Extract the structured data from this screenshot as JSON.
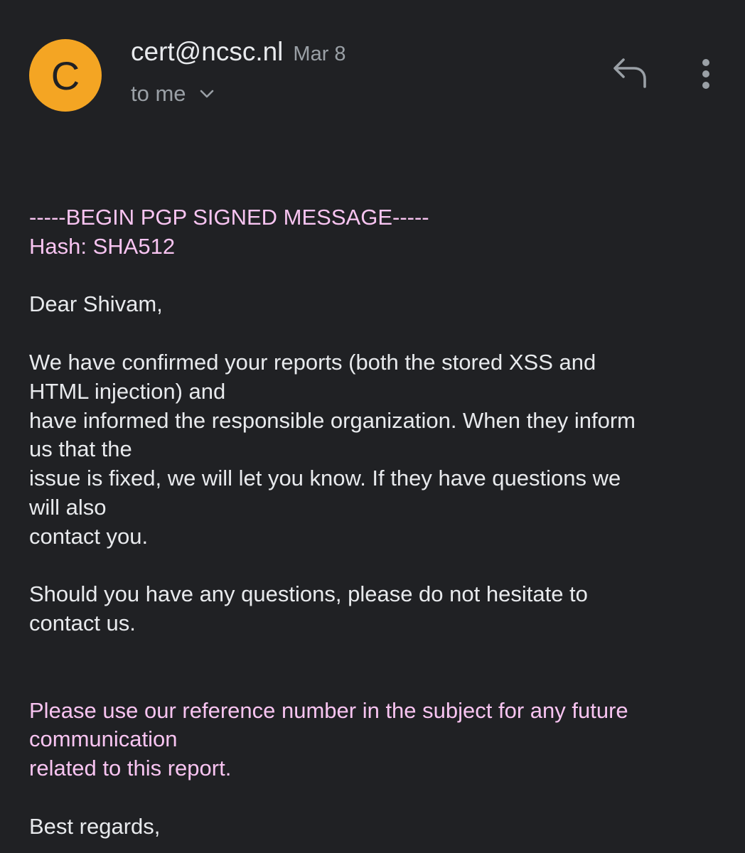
{
  "header": {
    "avatar_letter": "C",
    "sender": "cert@ncsc.nl",
    "date": "Mar 8",
    "recipient": "to me",
    "avatar_color": "#f4a523"
  },
  "icons": {
    "reply": "reply-icon",
    "more": "more-vert-icon",
    "expand": "chevron-down-icon"
  },
  "body": {
    "pgp_begin": "-----BEGIN PGP SIGNED MESSAGE-----",
    "hash": "Hash: SHA512",
    "greeting": "Dear Shivam,",
    "p1_l1": "We have confirmed your reports (both the stored XSS and",
    "p1_l2": "HTML injection) and",
    "p1_l3": "have informed the responsible organization. When they inform",
    "p1_l4": "us that the",
    "p1_l5": "issue is fixed, we will let you know. If they have questions we",
    "p1_l6": "will also",
    "p1_l7": "contact you.",
    "p2_l1": "Should you have any questions, please do not hesitate to",
    "p2_l2": "contact us.",
    "ref_l1": "Please use our reference number in the subject for any future",
    "ref_l2": "communication",
    "ref_l3": "related to this report.",
    "closing": "Best regards,"
  },
  "colors": {
    "background": "#202124",
    "text": "#e8eaed",
    "secondary_text": "#9aa0a6",
    "pgp_text": "#f8c4f1"
  }
}
